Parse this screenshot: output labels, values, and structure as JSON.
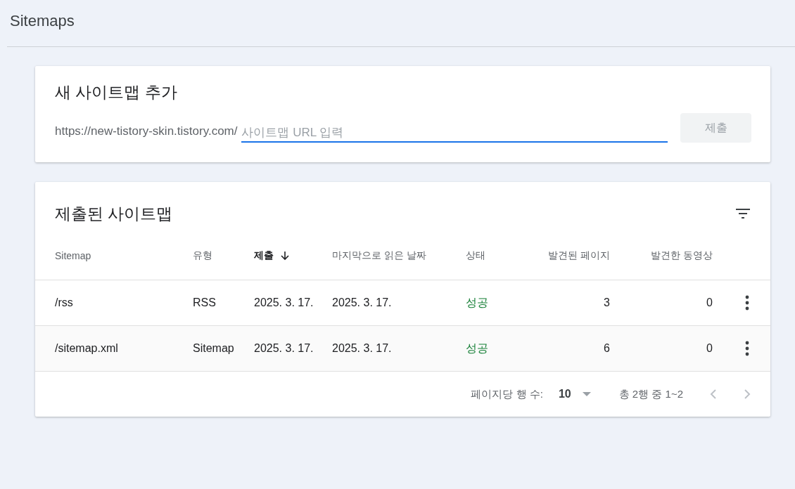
{
  "page_title": "Sitemaps",
  "add_card": {
    "title": "새 사이트맵 추가",
    "url_prefix": "https://new-tistory-skin.tistory.com/",
    "input": {
      "placeholder": "사이트맵 URL 입력",
      "focused": true
    },
    "submit": {
      "label": "제출",
      "disabled": true
    }
  },
  "list_card": {
    "title": "제출된 사이트맵",
    "columns": [
      {
        "label": "Sitemap",
        "sorted": false,
        "numeric": false
      },
      {
        "label": "유형",
        "sorted": false,
        "numeric": false
      },
      {
        "label": "제출",
        "sorted": true,
        "numeric": false
      },
      {
        "label": "마지막으로 읽은 날짜",
        "sorted": false,
        "numeric": false
      },
      {
        "label": "상태",
        "sorted": false,
        "numeric": false
      },
      {
        "label": "발견된 페이지",
        "sorted": false,
        "numeric": true
      },
      {
        "label": "발견한 동영상",
        "sorted": false,
        "numeric": true
      }
    ],
    "rows": [
      {
        "cells": [
          "/rss",
          "RSS",
          "2025. 3. 17.",
          "2025. 3. 17.",
          "성공",
          "3",
          "0"
        ],
        "color": "#188038"
      },
      {
        "cells": [
          "/sitemap.xml",
          "Sitemap",
          "2025. 3. 17.",
          "2025. 3. 17.",
          "성공",
          "6",
          "0"
        ],
        "color": "#188038"
      }
    ],
    "pagination": {
      "rows_label": "페이지당 행 수:",
      "rows_value": "10",
      "range": "총 2행 중 1~2",
      "prev_disabled": true,
      "next_disabled": true
    }
  }
}
